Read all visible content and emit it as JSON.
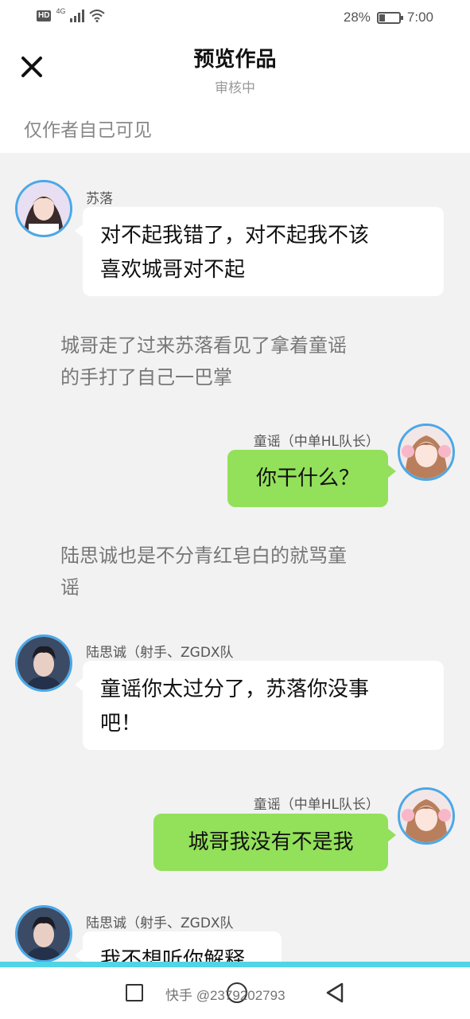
{
  "status_bar": {
    "hd": "HD",
    "network": "4G",
    "battery": "28%",
    "time": "7:00",
    "battery_level": 0.28
  },
  "header": {
    "title": "预览作品",
    "subtitle": "审核中",
    "close_icon": "close-icon"
  },
  "visibility_note": "仅作者自己可见",
  "messages": [
    {
      "type": "bubble",
      "side": "left",
      "sender": "苏落",
      "lines": [
        "对不起我错了，对不起我不该",
        "喜欢城哥对不起"
      ]
    },
    {
      "type": "narration",
      "lines": [
        "城哥走了过来苏落看见了拿着童谣",
        "的手打了自己一巴掌"
      ]
    },
    {
      "type": "bubble",
      "side": "right",
      "sender": "童谣（中单HL队长）",
      "lines": [
        "你干什么？"
      ]
    },
    {
      "type": "narration",
      "lines": [
        "陆思诚也是不分青红皂白的就骂童",
        "谣"
      ]
    },
    {
      "type": "bubble",
      "side": "left",
      "sender": "陆思诚（射手、ZGDX队",
      "lines": [
        "童谣你太过分了，苏落你没事",
        "吧！"
      ]
    },
    {
      "type": "bubble",
      "side": "right",
      "sender": "童谣（中单HL队长）",
      "lines": [
        "城哥我没有不是我"
      ]
    },
    {
      "type": "bubble",
      "side": "left",
      "sender": "陆思诚（射手、ZGDX队",
      "lines": [
        "我不想听你解释"
      ]
    }
  ],
  "nav_bar": {
    "watermark": "快手 @2379202793",
    "icons": [
      "recent-apps-icon",
      "home-icon",
      "back-icon"
    ]
  },
  "colors": {
    "bubble_right": "#93e05a",
    "bubble_left": "#ffffff",
    "avatar_border": "#4aa8e8",
    "nav_accent": "#4fd5e6"
  }
}
